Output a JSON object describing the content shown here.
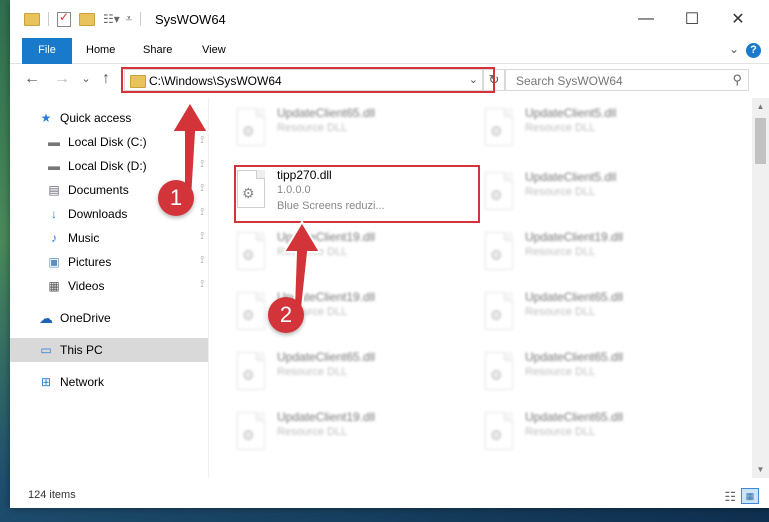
{
  "window": {
    "title": "SysWOW64",
    "minimize_glyph": "—",
    "maximize_glyph": "☐",
    "close_glyph": "✕"
  },
  "ribbon": {
    "tabs": [
      "File",
      "Home",
      "Share",
      "View"
    ],
    "help_glyph": "?",
    "collapse_glyph": "⌄"
  },
  "nav": {
    "back_glyph": "←",
    "forward_glyph": "→",
    "recent_glyph": "⌄",
    "up_glyph": "↑"
  },
  "address": {
    "path": "C:\\Windows\\SysWOW64",
    "dropdown_glyph": "⌄",
    "refresh_glyph": "↻"
  },
  "search": {
    "placeholder": "Search SysWOW64",
    "icon_glyph": "⚲"
  },
  "sidebar": {
    "items": [
      {
        "label": "Quick access",
        "icon": "star-icon",
        "glyph": "★",
        "pinned": false
      },
      {
        "label": "Local Disk (C:)",
        "icon": "drive-icon",
        "glyph": "▬",
        "pinned": true
      },
      {
        "label": "Local Disk (D:)",
        "icon": "drive-icon",
        "glyph": "▬",
        "pinned": true
      },
      {
        "label": "Documents",
        "icon": "documents-icon",
        "glyph": "▤",
        "pinned": true
      },
      {
        "label": "Downloads",
        "icon": "downloads-icon",
        "glyph": "↓",
        "pinned": true
      },
      {
        "label": "Music",
        "icon": "music-icon",
        "glyph": "♪",
        "pinned": true
      },
      {
        "label": "Pictures",
        "icon": "pictures-icon",
        "glyph": "▣",
        "pinned": true
      },
      {
        "label": "Videos",
        "icon": "videos-icon",
        "glyph": "▦",
        "pinned": true
      },
      {
        "label": "OneDrive",
        "icon": "cloud-icon",
        "glyph": "☁",
        "pinned": false
      },
      {
        "label": "This PC",
        "icon": "computer-icon",
        "glyph": "▭",
        "pinned": false
      },
      {
        "label": "Network",
        "icon": "network-icon",
        "glyph": "⊞",
        "pinned": false
      }
    ],
    "pin_glyph": "📌"
  },
  "files": {
    "left": [
      {
        "name": "UpdateClient65.dll",
        "line1": "Resource DLL",
        "line2": ""
      },
      {
        "name": "tipp270.dll",
        "line1": "1.0.0.0",
        "line2": "Blue Screens reduzi..."
      },
      {
        "name": "UpdateClient19.dll",
        "line1": "Resource DLL",
        "line2": ""
      },
      {
        "name": "UpdateClient19.dll",
        "line1": "Resource DLL",
        "line2": ""
      },
      {
        "name": "UpdateClient65.dll",
        "line1": "Resource DLL",
        "line2": ""
      },
      {
        "name": "UpdateClient19.dll",
        "line1": "Resource DLL",
        "line2": ""
      }
    ],
    "right": [
      {
        "name": "UpdateClient5.dll",
        "line1": "Resource DLL",
        "line2": ""
      },
      {
        "name": "UpdateClient5.dll",
        "line1": "Resource DLL",
        "line2": ""
      },
      {
        "name": "UpdateClient19.dll",
        "line1": "Resource DLL",
        "line2": ""
      },
      {
        "name": "UpdateClient65.dll",
        "line1": "Resource DLL",
        "line2": ""
      },
      {
        "name": "UpdateClient65.dll",
        "line1": "Resource DLL",
        "line2": ""
      },
      {
        "name": "UpdateClient65.dll",
        "line1": "Resource DLL",
        "line2": ""
      }
    ],
    "gear_glyph": "⚙"
  },
  "status": {
    "count": "124 items",
    "details_glyph": "☷",
    "tiles_glyph": "▦"
  },
  "annotations": {
    "badge1": "1",
    "badge2": "2",
    "accent": "#d3343a"
  },
  "colors": {
    "file_tab": "#1979ca",
    "selected_nav": "#d9d9d9"
  }
}
